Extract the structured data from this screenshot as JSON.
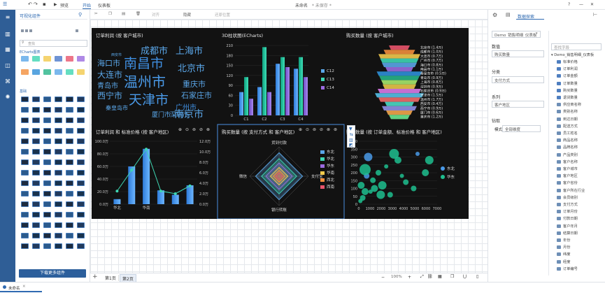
{
  "titlebar": {
    "preview": "预览",
    "start": "开始",
    "dashboard": "仪表板",
    "doc_title": "未命名",
    "unsaved": "* 未保存 *"
  },
  "left_panel": {
    "title": "可视化组件",
    "search_placeholder": "查找",
    "section_echarts": "ECharts图表",
    "section_basic": "基础",
    "download_button": "下载更多组件"
  },
  "toolbar": {
    "layout": "对齐",
    "display": "隐藏",
    "reset": "还原位置"
  },
  "charts": {
    "wordcloud": {
      "title": "订单利润 (按 客户城市)"
    },
    "bar3d": {
      "title": "3D柱状图(ECharts)"
    },
    "funnel": {
      "title": "购买数量 (按 客户城市)"
    },
    "combo": {
      "title": "订单利润 和 标准价格 (按 客户地区)"
    },
    "radar": {
      "title": "购买数量 (按 支付方式 和 客户地区)"
    },
    "scatter": {
      "title": "购买数量 (按 订单金额、标准价格 和 客户地区)"
    }
  },
  "chart_data": [
    {
      "type": "wordcloud",
      "words": [
        "成都市",
        "上海市",
        "海口市",
        "南昌市",
        "北京市",
        "大连市",
        "温州市",
        "重庆市",
        "青岛市",
        "西宁市",
        "天津市",
        "石家庄市",
        "广州市",
        "秦皇岛市",
        "厦门市",
        "深圳市",
        "南京市",
        "西安市"
      ]
    },
    {
      "type": "bar",
      "title": "3D柱状图(ECharts)",
      "categories": [
        "C1",
        "C2",
        "C3",
        "C4"
      ],
      "ylim": [
        0,
        210
      ],
      "yticks": [
        0,
        30,
        60,
        90,
        120,
        150,
        180,
        210
      ],
      "series": [
        {
          "name": "C12",
          "values": [
            70,
            85,
            155,
            140
          ]
        },
        {
          "name": "C13",
          "values": [
            115,
            205,
            175,
            175
          ]
        },
        {
          "name": "C14",
          "values": [
            50,
            70,
            145,
            115
          ]
        }
      ]
    },
    {
      "type": "funnel",
      "title": "购买数量 (按 客户城市)",
      "labels": [
        "北京市 (1.4万)",
        "成都市 (1.0万)",
        "大连市 (0.7万)",
        "广州市 (0.7万)",
        "海口市 (0.8万)",
        "南昌市 (1.1万)",
        "秦皇岛市 (0.5万)",
        "青岛市 (0.9万)",
        "上海市 (0.8万)",
        "深圳市 (0.9万)",
        "石家庄市 (0.9万)",
        "天津市 (1.5万)",
        "温州市 (1.7万)",
        "西安市 (0.4万)",
        "西宁市 (0.9万)",
        "厦门市 (0.6万)",
        "重庆市 (1.2万)"
      ]
    },
    {
      "type": "bar",
      "title": "订单利润 和 标准价格 (按 客户地区)",
      "categories": [
        "华北",
        "",
        "华南",
        "",
        "",
        ""
      ],
      "yticks_left": [
        "0.0万",
        "20.0万",
        "40.0万",
        "60.0万",
        "80.0万",
        "100.0万"
      ],
      "yticks_right": [
        "0.0万",
        "2.0万",
        "4.0万",
        "6.0万",
        "8.0万",
        "10.0万",
        "12.0万"
      ],
      "series": [
        {
          "name": "bar",
          "values": [
            8,
            60,
            88,
            22,
            15,
            30
          ]
        },
        {
          "name": "line",
          "values": [
            2.5,
            6.5,
            10.5,
            2.5,
            2.0,
            3.5
          ]
        }
      ]
    },
    {
      "type": "radar",
      "title": "购买数量 (按 支付方式 和 客户地区)",
      "indicators": [
        "货到付款",
        "支付宝",
        "银行转账",
        "微信"
      ],
      "series": [
        {
          "name": "东北",
          "color": "#5aa6e8"
        },
        {
          "name": "华北",
          "color": "#3ed6b2"
        },
        {
          "name": "华东",
          "color": "#9b6be0"
        },
        {
          "name": "华南",
          "color": "#f2c94c"
        },
        {
          "name": "西北",
          "color": "#f28e3c"
        },
        {
          "name": "西南",
          "color": "#e8546c"
        }
      ]
    },
    {
      "type": "scatter",
      "title": "购买数量 (按 订单金额、标准价格 和 客户地区)",
      "xticks": [
        "0",
        "1000",
        "2000",
        "3000",
        "4000",
        "5000",
        "6000",
        "7000"
      ],
      "yticks": [
        "0",
        "50",
        "100",
        "150",
        "200",
        "250",
        "300",
        "350",
        "400"
      ],
      "series": [
        {
          "name": "东北",
          "color": "#4a9ae8"
        },
        {
          "name": "华东",
          "color": "#1fbf8f"
        }
      ]
    }
  ],
  "canvas_pages": {
    "add": "+",
    "page1": "第1页",
    "page2": "第2页",
    "zoom": "100%"
  },
  "status": {
    "doc": "未命名"
  },
  "right_panel": {
    "tab": "数据探索",
    "dataset_select": "Demo_销售明细_仪表板",
    "search_placeholder": "查找字段",
    "value_label": "数值",
    "value_field": "购买数量",
    "category_label": "分类",
    "category_field": "支付方式",
    "series_label": "系列",
    "series_field": "客户地区",
    "drill_label": "钻取",
    "mode_label": "模式",
    "mode_value": "全部维度",
    "tree_root": "Demo_销售明细_仪表板",
    "tree_items": [
      "标准价格",
      "订单利润",
      "订单金额",
      "订单数量",
      "购买数量",
      "退货数量",
      "供应商名称",
      "类别名称",
      "到达日期",
      "配送方式",
      "员工姓名",
      "商品名称",
      "品牌名称",
      "产品类别",
      "客户名称",
      "客户城市",
      "客户地区",
      "客户省份",
      "客户所在行业",
      "会员级别",
      "支付方式",
      "订单月份",
      "付款日期",
      "客户年月",
      "结算日期",
      "年份",
      "月份",
      "纬度",
      "经度",
      "订单编号"
    ]
  }
}
